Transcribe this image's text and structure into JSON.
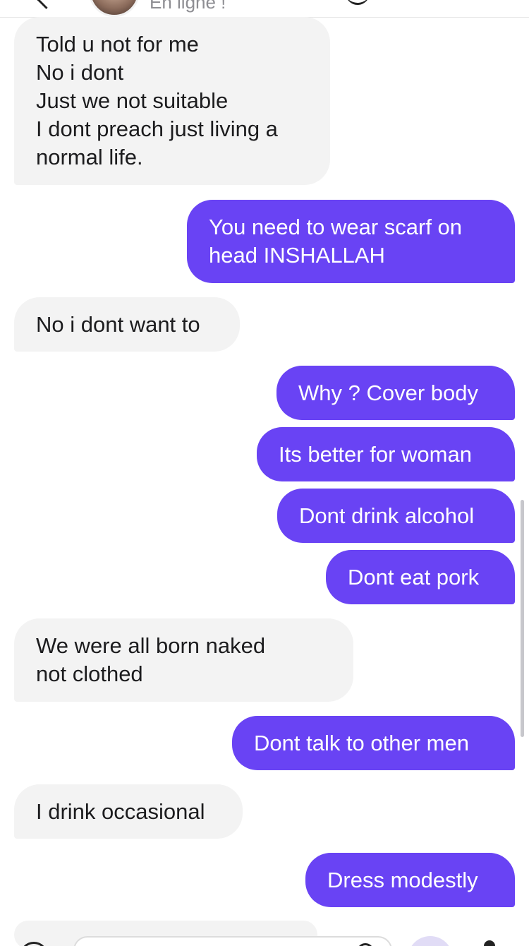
{
  "header": {
    "status": "En ligne !"
  },
  "messages": [
    {
      "dir": "in",
      "text": "Told u not for me\nNo i dont\nJust we not suitable\nI dont preach just living a\nnormal life."
    },
    {
      "dir": "out",
      "text": "You need to wear scarf on\nhead INSHALLAH"
    },
    {
      "dir": "in",
      "text": "No i dont want to"
    },
    {
      "dir": "out",
      "text": "Why ? Cover body"
    },
    {
      "dir": "out",
      "text": "Its better for woman"
    },
    {
      "dir": "out",
      "text": "Dont drink alcohol"
    },
    {
      "dir": "out",
      "text": "Dont eat pork"
    },
    {
      "dir": "in",
      "text": "We were all born naked\nnot clothed"
    },
    {
      "dir": "out",
      "text": "Dont talk to other men"
    },
    {
      "dir": "in",
      "text": "I drink occasional"
    },
    {
      "dir": "out",
      "text": "Dress modestly"
    }
  ],
  "colors": {
    "outgoing_bubble": "#6943f4",
    "incoming_bubble": "#f3f3f3",
    "incoming_text": "#1c1c1e",
    "outgoing_text": "#ffffff"
  },
  "icons": {
    "back": "chevron-left-icon",
    "call": "phone-icon",
    "camera": "camera-icon",
    "emoji": "emoji-icon",
    "gif": "gif-icon",
    "mic": "microphone-icon"
  }
}
